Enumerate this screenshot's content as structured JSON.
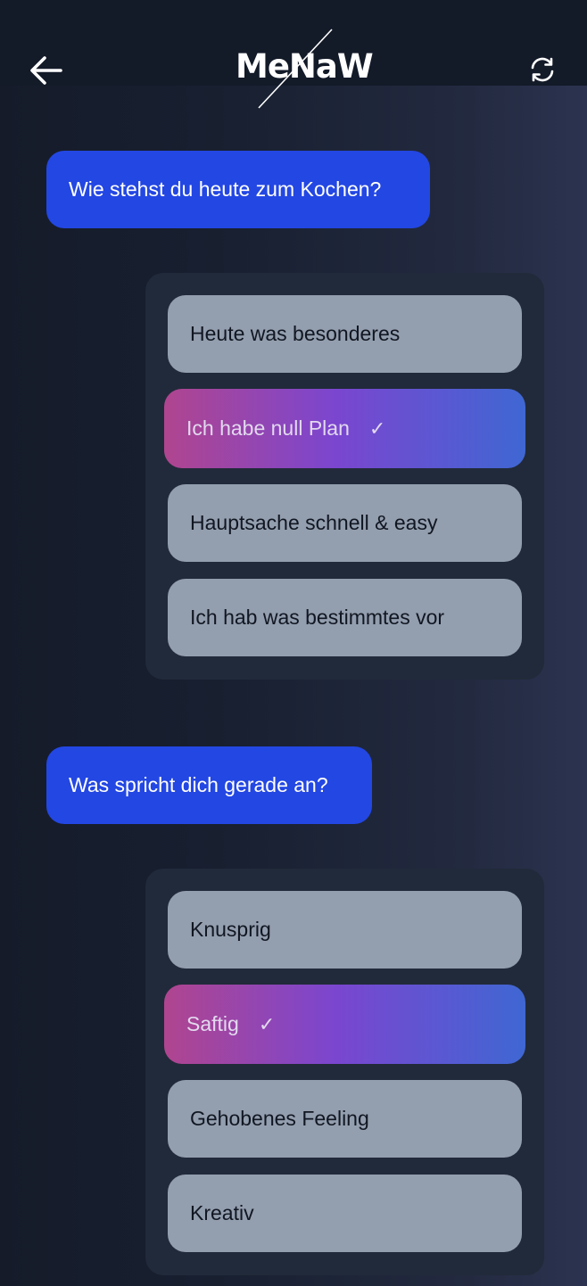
{
  "header": {
    "logo_text": "MeNaW"
  },
  "conversation": [
    {
      "question": "Wie stehst du heute zum Kochen?",
      "options": [
        {
          "label": "Heute was besonderes",
          "selected": false
        },
        {
          "label": "Ich habe null Plan",
          "selected": true
        },
        {
          "label": "Hauptsache schnell & easy",
          "selected": false
        },
        {
          "label": "Ich hab was bestimmtes vor",
          "selected": false
        }
      ]
    },
    {
      "question": "Was spricht dich gerade an?",
      "options": [
        {
          "label": "Knusprig",
          "selected": false
        },
        {
          "label": "Saftig",
          "selected": true
        },
        {
          "label": "Gehobenes Feeling",
          "selected": false
        },
        {
          "label": "Kreativ",
          "selected": false
        }
      ]
    }
  ],
  "icons": {
    "back": "arrow-left-icon",
    "refresh": "refresh-icon",
    "check": "checkmark-icon",
    "check_glyph": "✓"
  },
  "colors": {
    "background": "#131a28",
    "question_bubble": "#2347e3",
    "option": "#939eae",
    "option_group": "#212a3a",
    "selected_gradient_start": "#b0458f",
    "selected_gradient_mid": "#7a46d0",
    "selected_gradient_end": "#3f67d3"
  }
}
